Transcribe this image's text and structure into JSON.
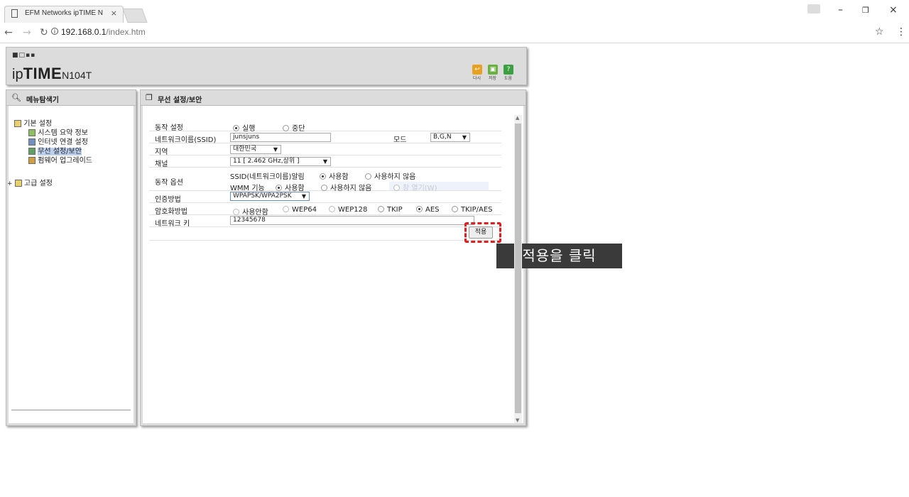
{
  "browser": {
    "tab_title": "EFM Networks ipTIME N",
    "tab_close": "×",
    "url_host": "192.168.0.1",
    "url_path": "/index.htm",
    "minimize": "–",
    "restore": "❐",
    "close": "×"
  },
  "header": {
    "logo_prefix": "ip",
    "logo_brand": "TIME",
    "logo_model": "N104T",
    "buttons": [
      {
        "label": "다시",
        "icon": "↩",
        "color": "#e8a020"
      },
      {
        "label": "저장",
        "icon": "▣",
        "color": "#6ab040"
      },
      {
        "label": "도움",
        "icon": "?",
        "color": "#3aa040"
      }
    ]
  },
  "left_panel": {
    "title": "메뉴탐색기",
    "tree": [
      {
        "label": "기본 설정",
        "level": 0
      },
      {
        "label": "시스템 요약 정보",
        "level": 1
      },
      {
        "label": "인터넷 연결 설정",
        "level": 1
      },
      {
        "label": "무선 설정/보안",
        "level": 1,
        "selected": true
      },
      {
        "label": "펌웨어 업그레이드",
        "level": 1
      },
      {
        "label": "고급 설정",
        "level": 0
      }
    ]
  },
  "main_panel": {
    "title": "무선 설정/보안",
    "fields": {
      "operation_label": "동작 설정",
      "operation_on": "실행",
      "operation_off": "중단",
      "ssid_label": "네트워크이름(SSID)",
      "ssid_value": "junsjuns",
      "mode_label": "모드",
      "mode_value": "B,G,N",
      "region_label": "지역",
      "region_value": "대한민국",
      "channel_label": "채널",
      "channel_value": "11 [ 2.462 GHz,상위 ]",
      "option_label": "동작 옵션",
      "ssid_broadcast_label": "SSID(네트워크이름)알림",
      "use": "사용함",
      "not_use": "사용하지 않음",
      "wmm_label": "WMM 기능",
      "faded_option": "창 열기(W)",
      "auth_label": "인증방법",
      "auth_value": "WPAPSK/WPA2PSK",
      "enc_label": "암호화방법",
      "enc_options": [
        "사용안함",
        "WEP64",
        "WEP128",
        "TKIP",
        "AES",
        "TKIP/AES"
      ],
      "enc_selected": "AES",
      "key_label": "네트워크 키",
      "key_value": "12345678",
      "apply": "적용"
    }
  },
  "annotation": {
    "callout": "적용을 클릭",
    "highlight_color": "#e02020"
  }
}
